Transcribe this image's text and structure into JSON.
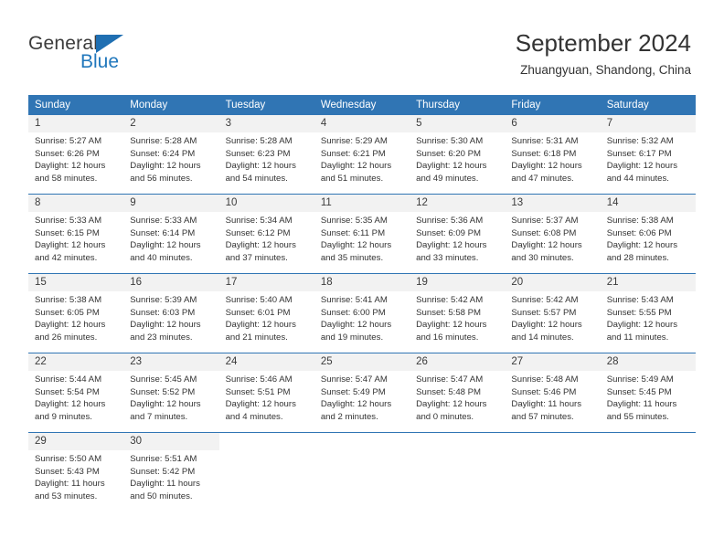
{
  "brand": {
    "name_top": "General",
    "name_bottom": "Blue",
    "triangle_icon": "blue-triangle-icon",
    "accent_color": "#2077bc"
  },
  "header": {
    "title": "September 2024",
    "subtitle": "Zhuangyuan, Shandong, China"
  },
  "colors": {
    "header_row": "#3075b4",
    "day_band": "#f2f2f2",
    "text": "#333333"
  },
  "calendar": {
    "weekday_headers": [
      "Sunday",
      "Monday",
      "Tuesday",
      "Wednesday",
      "Thursday",
      "Friday",
      "Saturday"
    ],
    "weeks": [
      [
        {
          "day": "1",
          "sunrise": "Sunrise: 5:27 AM",
          "sunset": "Sunset: 6:26 PM",
          "daylight1": "Daylight: 12 hours",
          "daylight2": "and 58 minutes."
        },
        {
          "day": "2",
          "sunrise": "Sunrise: 5:28 AM",
          "sunset": "Sunset: 6:24 PM",
          "daylight1": "Daylight: 12 hours",
          "daylight2": "and 56 minutes."
        },
        {
          "day": "3",
          "sunrise": "Sunrise: 5:28 AM",
          "sunset": "Sunset: 6:23 PM",
          "daylight1": "Daylight: 12 hours",
          "daylight2": "and 54 minutes."
        },
        {
          "day": "4",
          "sunrise": "Sunrise: 5:29 AM",
          "sunset": "Sunset: 6:21 PM",
          "daylight1": "Daylight: 12 hours",
          "daylight2": "and 51 minutes."
        },
        {
          "day": "5",
          "sunrise": "Sunrise: 5:30 AM",
          "sunset": "Sunset: 6:20 PM",
          "daylight1": "Daylight: 12 hours",
          "daylight2": "and 49 minutes."
        },
        {
          "day": "6",
          "sunrise": "Sunrise: 5:31 AM",
          "sunset": "Sunset: 6:18 PM",
          "daylight1": "Daylight: 12 hours",
          "daylight2": "and 47 minutes."
        },
        {
          "day": "7",
          "sunrise": "Sunrise: 5:32 AM",
          "sunset": "Sunset: 6:17 PM",
          "daylight1": "Daylight: 12 hours",
          "daylight2": "and 44 minutes."
        }
      ],
      [
        {
          "day": "8",
          "sunrise": "Sunrise: 5:33 AM",
          "sunset": "Sunset: 6:15 PM",
          "daylight1": "Daylight: 12 hours",
          "daylight2": "and 42 minutes."
        },
        {
          "day": "9",
          "sunrise": "Sunrise: 5:33 AM",
          "sunset": "Sunset: 6:14 PM",
          "daylight1": "Daylight: 12 hours",
          "daylight2": "and 40 minutes."
        },
        {
          "day": "10",
          "sunrise": "Sunrise: 5:34 AM",
          "sunset": "Sunset: 6:12 PM",
          "daylight1": "Daylight: 12 hours",
          "daylight2": "and 37 minutes."
        },
        {
          "day": "11",
          "sunrise": "Sunrise: 5:35 AM",
          "sunset": "Sunset: 6:11 PM",
          "daylight1": "Daylight: 12 hours",
          "daylight2": "and 35 minutes."
        },
        {
          "day": "12",
          "sunrise": "Sunrise: 5:36 AM",
          "sunset": "Sunset: 6:09 PM",
          "daylight1": "Daylight: 12 hours",
          "daylight2": "and 33 minutes."
        },
        {
          "day": "13",
          "sunrise": "Sunrise: 5:37 AM",
          "sunset": "Sunset: 6:08 PM",
          "daylight1": "Daylight: 12 hours",
          "daylight2": "and 30 minutes."
        },
        {
          "day": "14",
          "sunrise": "Sunrise: 5:38 AM",
          "sunset": "Sunset: 6:06 PM",
          "daylight1": "Daylight: 12 hours",
          "daylight2": "and 28 minutes."
        }
      ],
      [
        {
          "day": "15",
          "sunrise": "Sunrise: 5:38 AM",
          "sunset": "Sunset: 6:05 PM",
          "daylight1": "Daylight: 12 hours",
          "daylight2": "and 26 minutes."
        },
        {
          "day": "16",
          "sunrise": "Sunrise: 5:39 AM",
          "sunset": "Sunset: 6:03 PM",
          "daylight1": "Daylight: 12 hours",
          "daylight2": "and 23 minutes."
        },
        {
          "day": "17",
          "sunrise": "Sunrise: 5:40 AM",
          "sunset": "Sunset: 6:01 PM",
          "daylight1": "Daylight: 12 hours",
          "daylight2": "and 21 minutes."
        },
        {
          "day": "18",
          "sunrise": "Sunrise: 5:41 AM",
          "sunset": "Sunset: 6:00 PM",
          "daylight1": "Daylight: 12 hours",
          "daylight2": "and 19 minutes."
        },
        {
          "day": "19",
          "sunrise": "Sunrise: 5:42 AM",
          "sunset": "Sunset: 5:58 PM",
          "daylight1": "Daylight: 12 hours",
          "daylight2": "and 16 minutes."
        },
        {
          "day": "20",
          "sunrise": "Sunrise: 5:42 AM",
          "sunset": "Sunset: 5:57 PM",
          "daylight1": "Daylight: 12 hours",
          "daylight2": "and 14 minutes."
        },
        {
          "day": "21",
          "sunrise": "Sunrise: 5:43 AM",
          "sunset": "Sunset: 5:55 PM",
          "daylight1": "Daylight: 12 hours",
          "daylight2": "and 11 minutes."
        }
      ],
      [
        {
          "day": "22",
          "sunrise": "Sunrise: 5:44 AM",
          "sunset": "Sunset: 5:54 PM",
          "daylight1": "Daylight: 12 hours",
          "daylight2": "and 9 minutes."
        },
        {
          "day": "23",
          "sunrise": "Sunrise: 5:45 AM",
          "sunset": "Sunset: 5:52 PM",
          "daylight1": "Daylight: 12 hours",
          "daylight2": "and 7 minutes."
        },
        {
          "day": "24",
          "sunrise": "Sunrise: 5:46 AM",
          "sunset": "Sunset: 5:51 PM",
          "daylight1": "Daylight: 12 hours",
          "daylight2": "and 4 minutes."
        },
        {
          "day": "25",
          "sunrise": "Sunrise: 5:47 AM",
          "sunset": "Sunset: 5:49 PM",
          "daylight1": "Daylight: 12 hours",
          "daylight2": "and 2 minutes."
        },
        {
          "day": "26",
          "sunrise": "Sunrise: 5:47 AM",
          "sunset": "Sunset: 5:48 PM",
          "daylight1": "Daylight: 12 hours",
          "daylight2": "and 0 minutes."
        },
        {
          "day": "27",
          "sunrise": "Sunrise: 5:48 AM",
          "sunset": "Sunset: 5:46 PM",
          "daylight1": "Daylight: 11 hours",
          "daylight2": "and 57 minutes."
        },
        {
          "day": "28",
          "sunrise": "Sunrise: 5:49 AM",
          "sunset": "Sunset: 5:45 PM",
          "daylight1": "Daylight: 11 hours",
          "daylight2": "and 55 minutes."
        }
      ],
      [
        {
          "day": "29",
          "sunrise": "Sunrise: 5:50 AM",
          "sunset": "Sunset: 5:43 PM",
          "daylight1": "Daylight: 11 hours",
          "daylight2": "and 53 minutes."
        },
        {
          "day": "30",
          "sunrise": "Sunrise: 5:51 AM",
          "sunset": "Sunset: 5:42 PM",
          "daylight1": "Daylight: 11 hours",
          "daylight2": "and 50 minutes."
        },
        {
          "day": "",
          "sunrise": "",
          "sunset": "",
          "daylight1": "",
          "daylight2": ""
        },
        {
          "day": "",
          "sunrise": "",
          "sunset": "",
          "daylight1": "",
          "daylight2": ""
        },
        {
          "day": "",
          "sunrise": "",
          "sunset": "",
          "daylight1": "",
          "daylight2": ""
        },
        {
          "day": "",
          "sunrise": "",
          "sunset": "",
          "daylight1": "",
          "daylight2": ""
        },
        {
          "day": "",
          "sunrise": "",
          "sunset": "",
          "daylight1": "",
          "daylight2": ""
        }
      ]
    ]
  }
}
